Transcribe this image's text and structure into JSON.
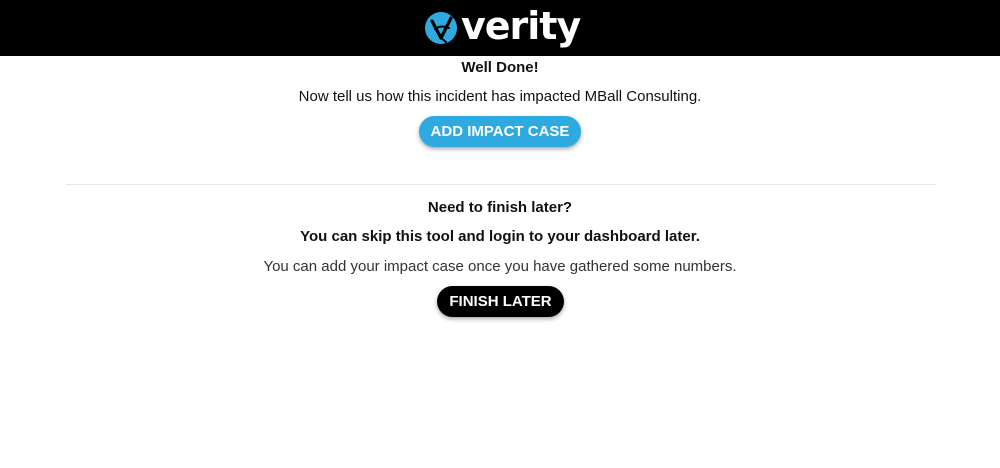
{
  "header": {
    "brand": "verity",
    "logo_icon": "verity-logo-mark-icon",
    "background": "#000000",
    "accent": "#2eaae1"
  },
  "section_impact": {
    "title": "Well Done!",
    "message": "Now tell us how this incident has impacted MBall Consulting.",
    "button_label": "ADD IMPACT CASE",
    "button_color": "#2eaae1"
  },
  "section_later": {
    "title": "Need to finish later?",
    "subtitle": "You can skip this tool and login to your dashboard later.",
    "note": "You can add your impact case once you have gathered some numbers.",
    "button_label": "FINISH LATER",
    "button_color": "#000000"
  }
}
